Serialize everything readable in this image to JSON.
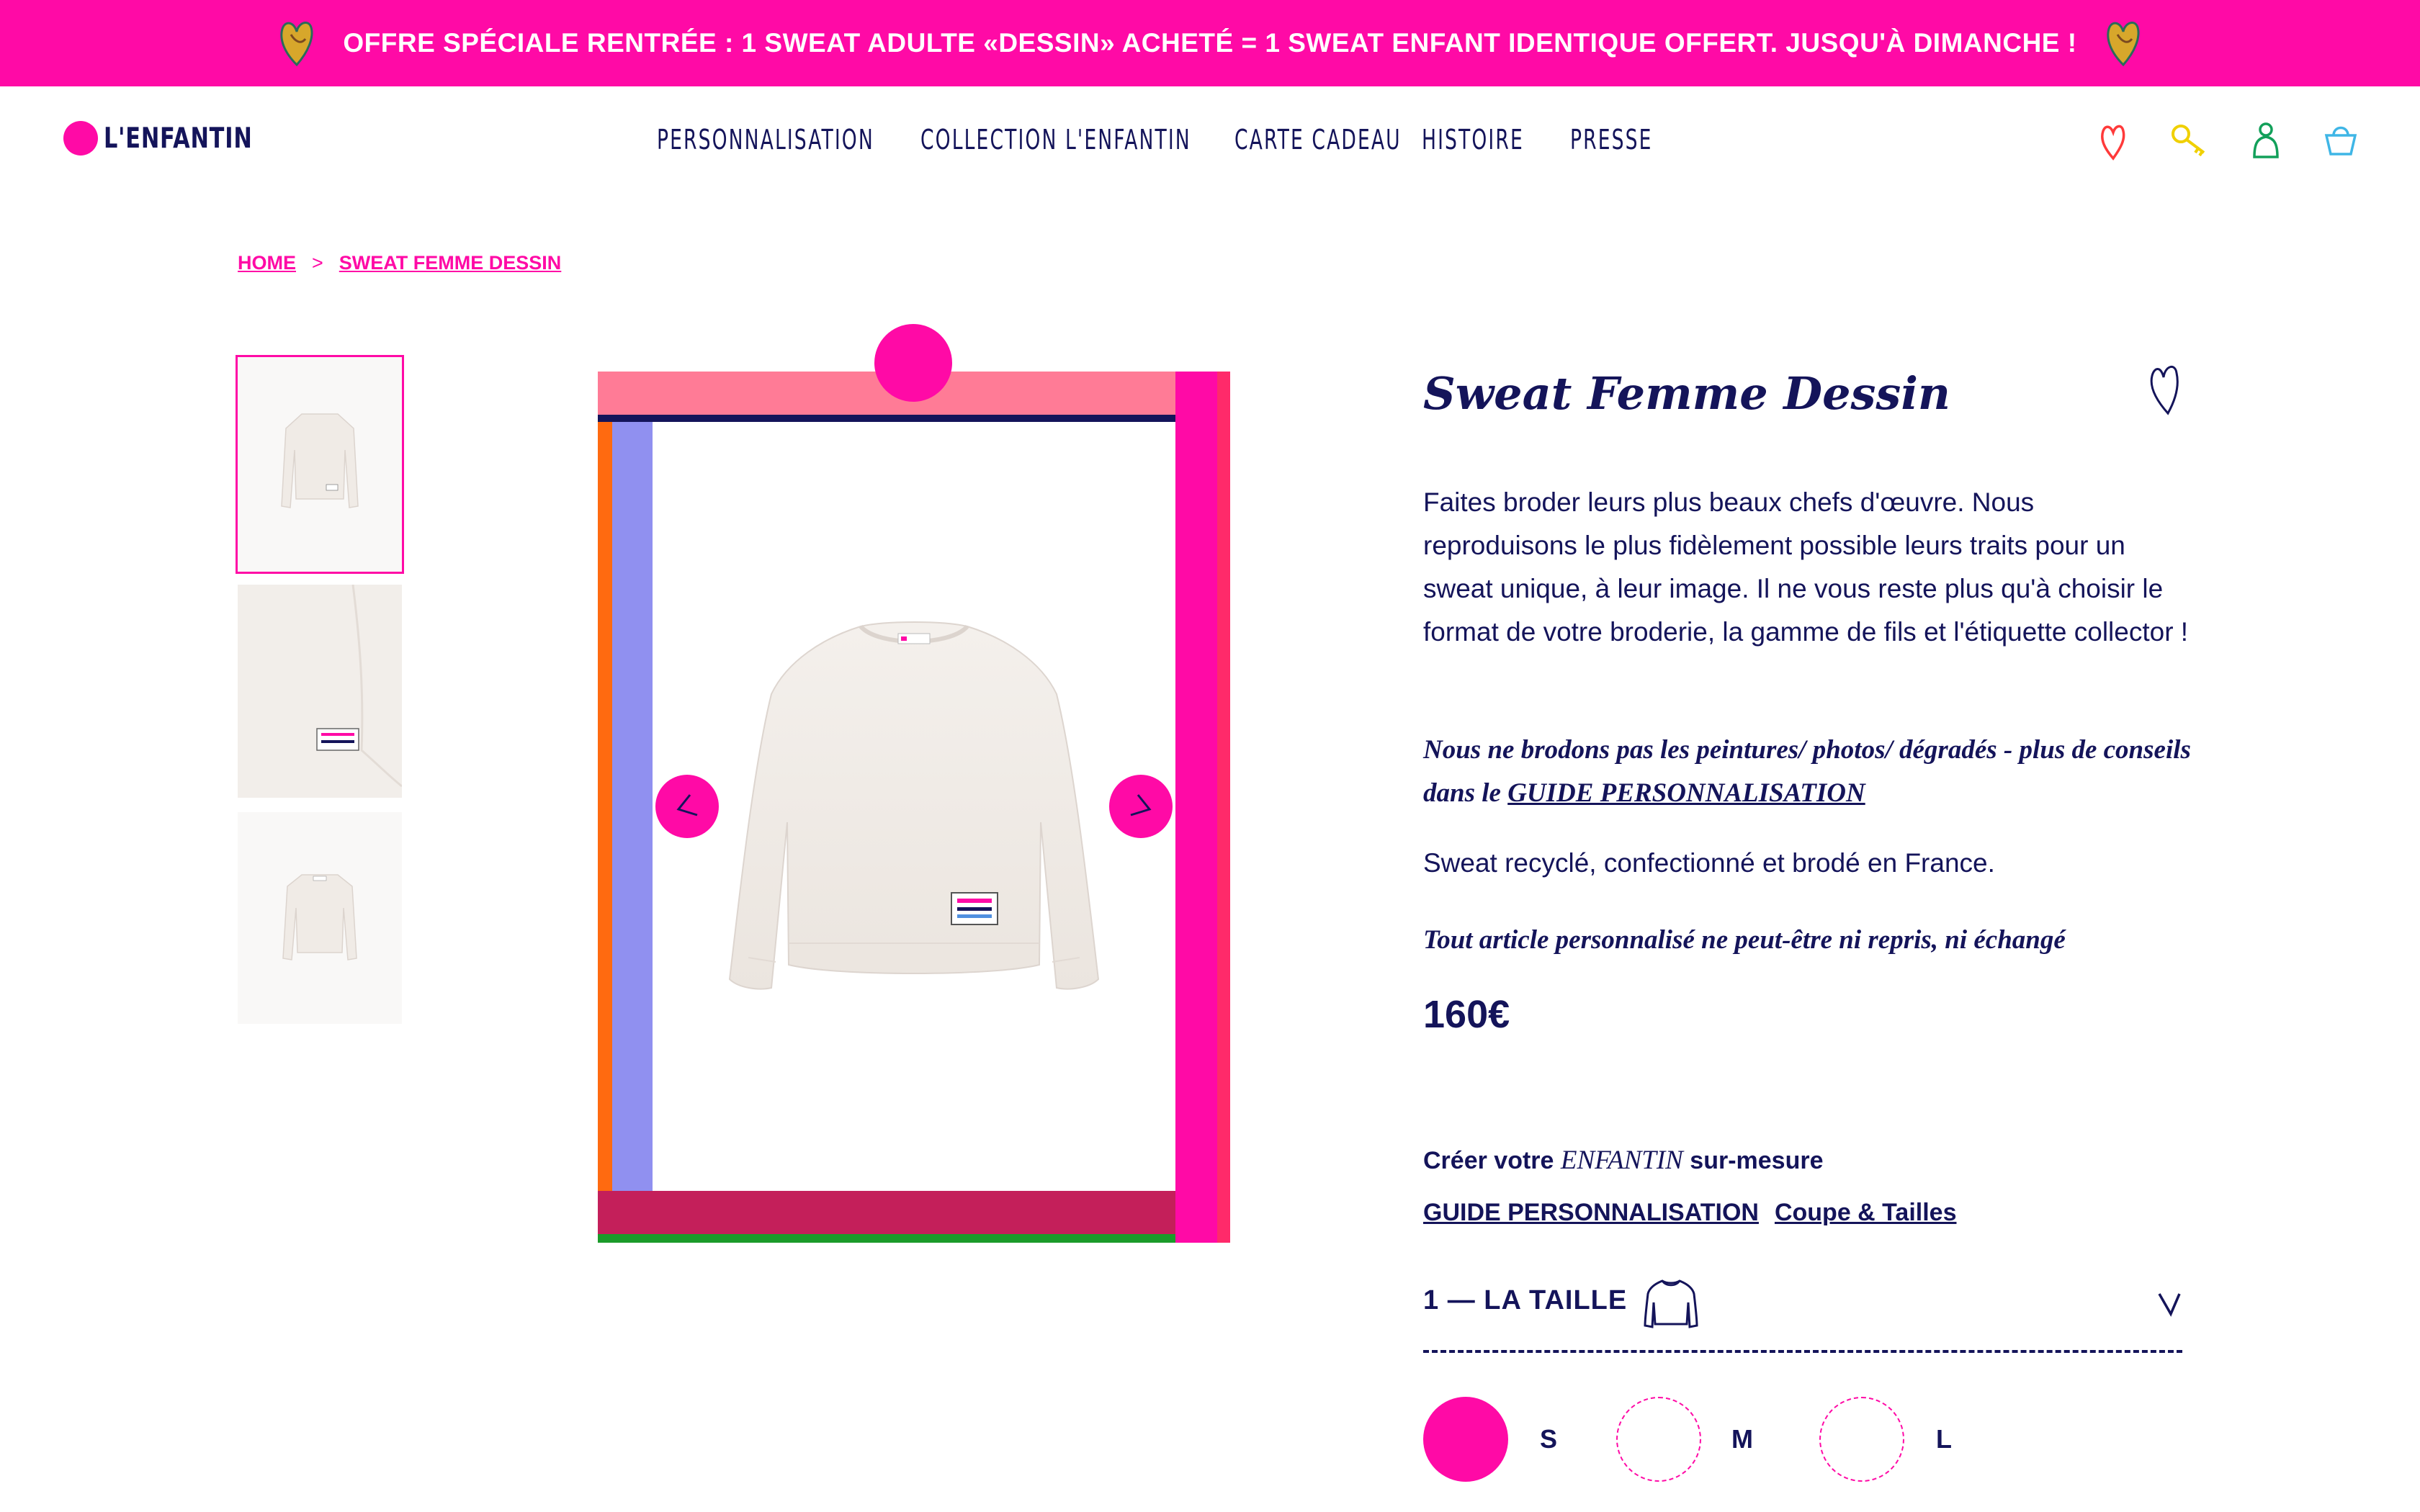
{
  "promo": {
    "text": "OFFRE SPÉCIALE RENTRÉE : 1 SWEAT ADULTE «DESSIN» ACHETÉ = 1 SWEAT ENFANT IDENTIQUE OFFERT. JUSQU'À DIMANCHE !",
    "icon": "heart-drawing-icon"
  },
  "header": {
    "logo": "L'ENFANTIN",
    "nav": [
      "PERSONNALISATION",
      "COLLECTION L'ENFANTIN",
      "CARTE CADEAU",
      "HISTOIRE",
      "PRESSE"
    ],
    "icons": [
      "heart-icon",
      "key-icon",
      "account-icon",
      "basket-icon"
    ]
  },
  "breadcrumb": {
    "home": "HOME",
    "separator": ">",
    "current": "SWEAT FEMME DESSIN"
  },
  "gallery": {
    "thumbnails": 3,
    "active_index": 0,
    "frame_colors": [
      "#ff7b96",
      "#14145a",
      "#ff6a10",
      "#9090f0",
      "#ff0aa6",
      "#c41f5a",
      "#1b9b2a"
    ]
  },
  "product": {
    "title": "Sweat Femme Dessin",
    "description": "Faites broder leurs plus beaux chefs d'œuvre.  Nous reproduisons le plus fidèlement possible leurs traits pour un sweat unique, à leur image. Il ne vous reste plus qu'à choisir le format de votre broderie, la gamme de fils et l'étiquette collector !",
    "note_prefix": "Nous ne brodons pas les peintures/ photos/ dégradés - plus de conseils dans le ",
    "note_link": "GUIDE PERSONNALISATION",
    "origin": "Sweat recyclé, confectionné et brodé en France.",
    "disclaimer": "Tout article personnalisé ne peut-être ni repris, ni échangé",
    "price": "160€"
  },
  "customize": {
    "heading_prefix": "Créer votre ",
    "heading_brand": "ENFANTIN",
    "heading_suffix": " sur-mesure",
    "guide_link": "GUIDE PERSONNALISATION",
    "sizes_link": "Coupe & Tailles",
    "step_label": "1 — LA TAILLE",
    "sizes": [
      "S",
      "M",
      "L"
    ],
    "selected_size": "S"
  },
  "colors": {
    "accent": "#ff0aa6",
    "navy": "#14145a"
  }
}
